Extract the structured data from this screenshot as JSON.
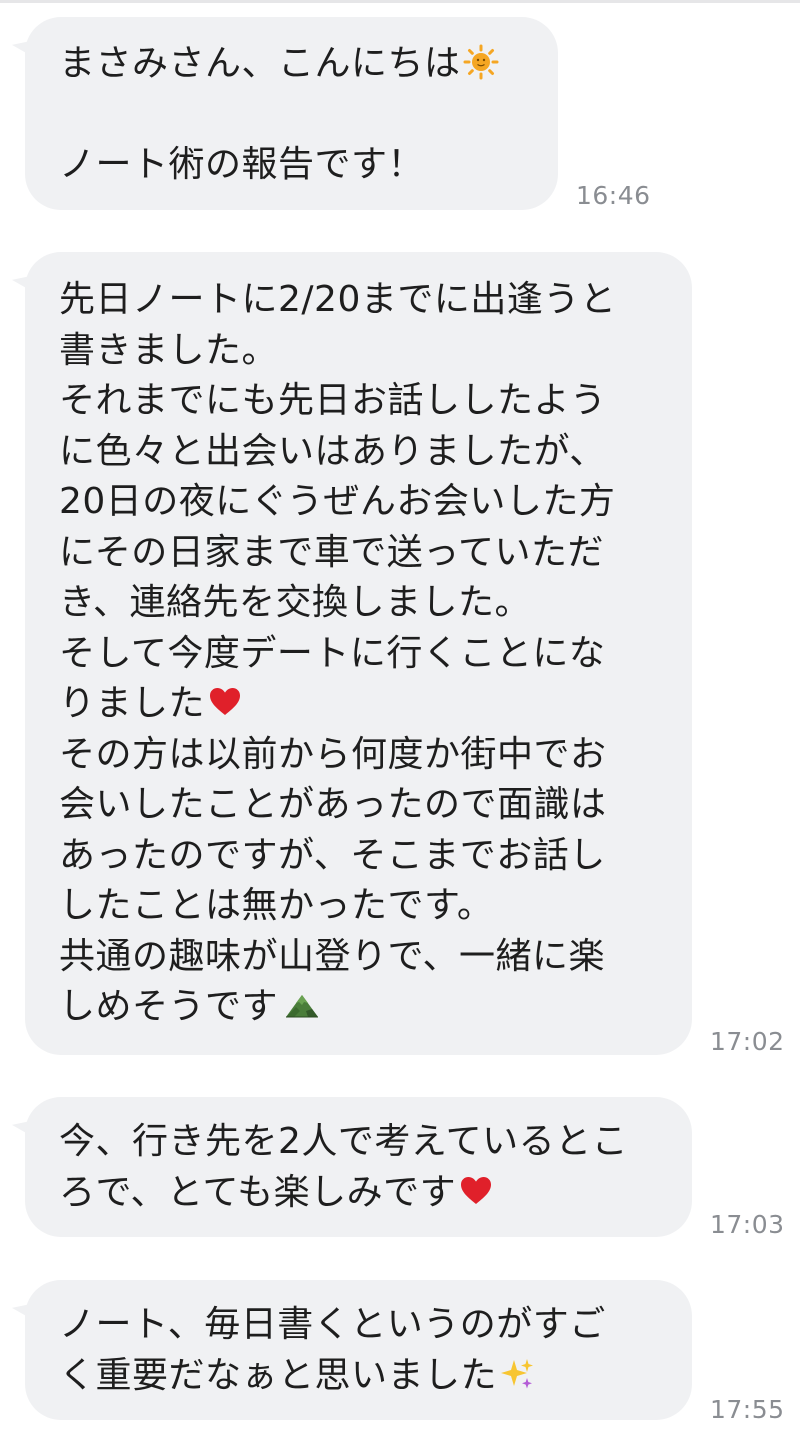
{
  "messages": [
    {
      "lines": [
        "まさみさん、こんにちは",
        "",
        "ノート術の報告です！"
      ],
      "emoji_after_line": {
        "0": "sun-icon"
      },
      "time": "16:46"
    },
    {
      "lines": [
        "先日ノートに2/20までに出逢うと",
        "書きました。",
        "それまでにも先日お話ししたよう",
        "に色々と出会いはありましたが、",
        "20日の夜にぐうぜんお会いした方",
        "にその日家まで車で送っていただ",
        "き、連絡先を交換しました。",
        "そして今度デートに行くことにな",
        "りました",
        "その方は以前から何度か街中でお",
        "会いしたことがあったので面識は",
        "あったのですが、そこまでお話し",
        "したことは無かったです。",
        "共通の趣味が山登りで、一緒に楽",
        "しめそうです"
      ],
      "emoji_after_line": {
        "8": "heart-icon",
        "14": "mountain-icon"
      },
      "time": "17:02"
    },
    {
      "lines": [
        "今、行き先を2人で考えているとこ",
        "ろで、とても楽しみです"
      ],
      "emoji_after_line": {
        "1": "heart-icon"
      },
      "time": "17:03"
    },
    {
      "lines": [
        "ノート、毎日書くというのがすご",
        "く重要だなぁと思いました"
      ],
      "emoji_after_line": {
        "1": "sparkles-icon"
      },
      "time": "17:55"
    }
  ]
}
